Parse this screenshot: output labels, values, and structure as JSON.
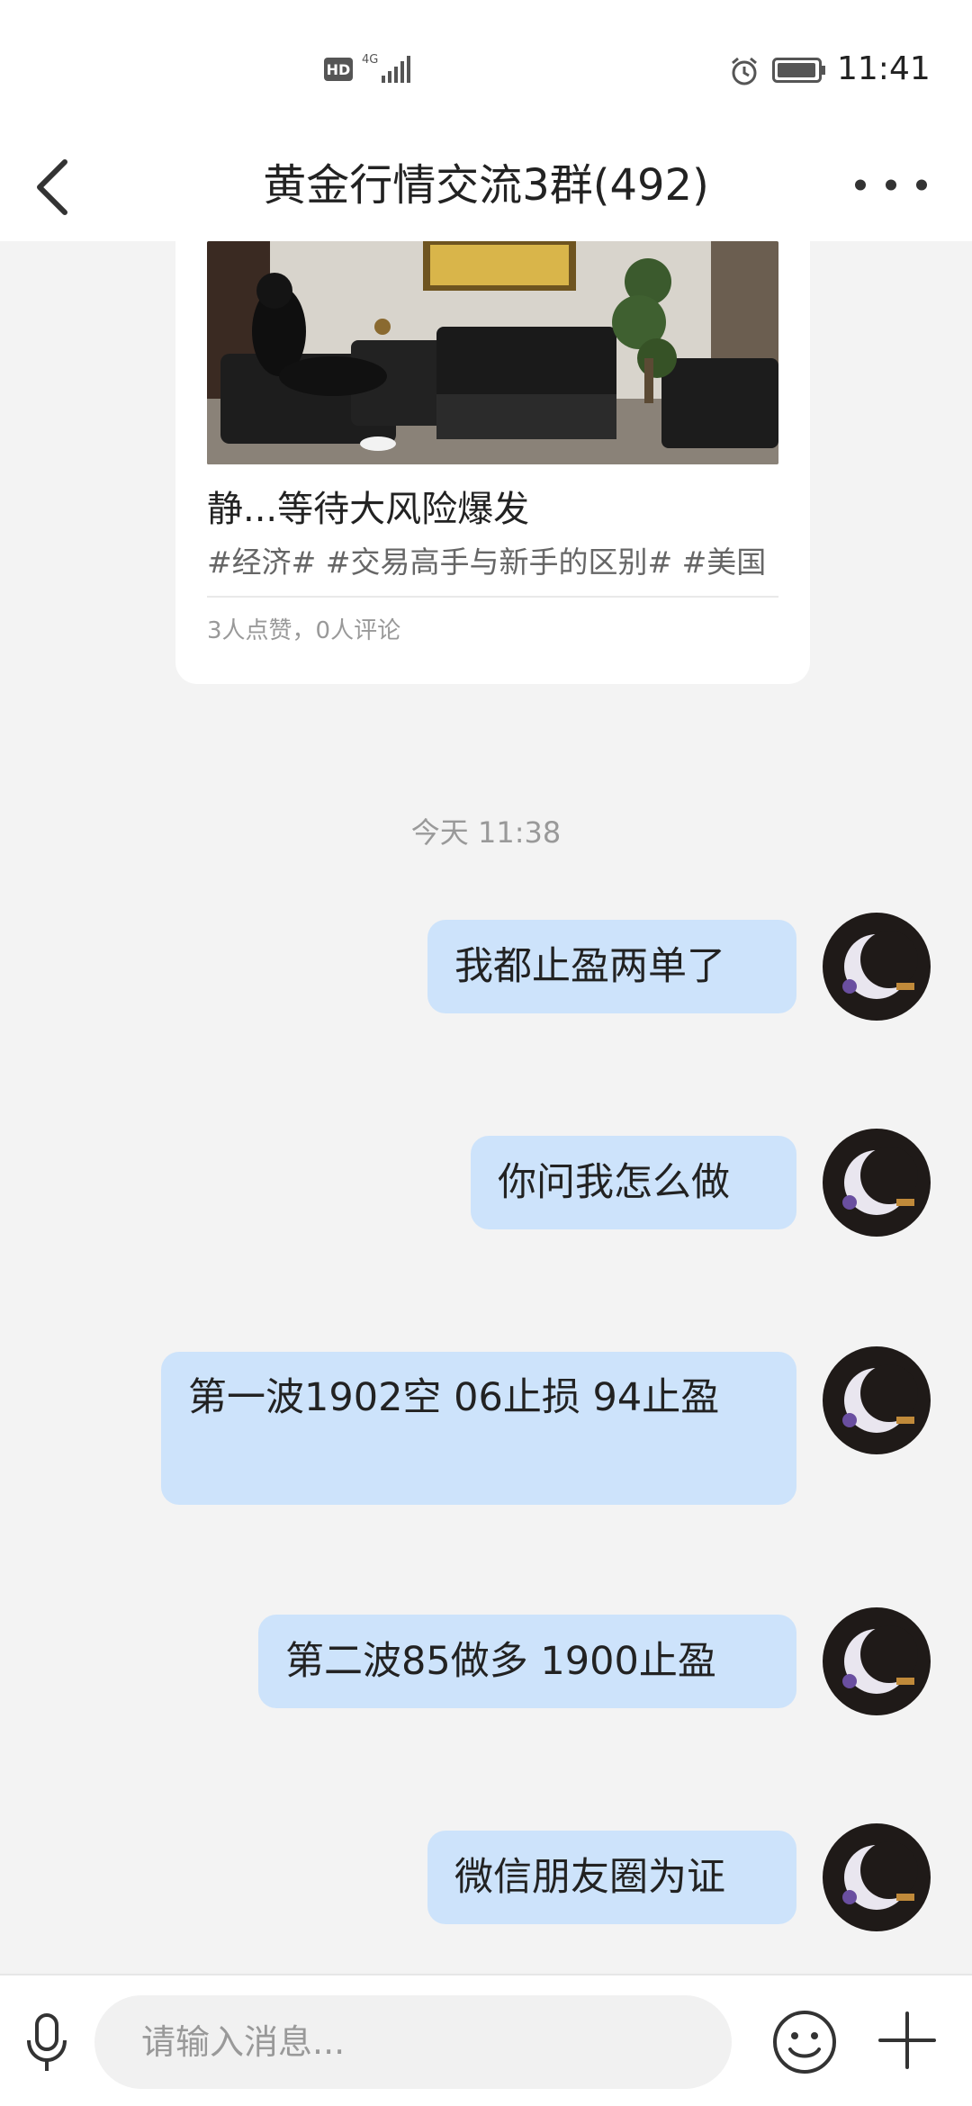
{
  "status_bar": {
    "hd": "HD",
    "network": "4G",
    "time": "11:41"
  },
  "header": {
    "title": "黄金行情交流3群(492)",
    "back_icon": "chevron-left-icon",
    "more_icon": "more-dots-icon"
  },
  "post_card": {
    "title": "静...等待大风险爆发",
    "tags": "#经济# #交易高手与新手的区别# #美国",
    "stats": "3人点赞，0人评论"
  },
  "time_separator": "今天 11:38",
  "messages": [
    {
      "text": "我都止盈两单了"
    },
    {
      "text": "你问我怎么做"
    },
    {
      "text": "第一波1902空  06止损 94止盈"
    },
    {
      "text": "第二波85做多  1900止盈"
    },
    {
      "text": "微信朋友圈为证"
    }
  ],
  "input_bar": {
    "placeholder": "请输入消息...",
    "mic_icon": "microphone-icon",
    "emoji_icon": "emoji-icon",
    "plus_icon": "plus-icon"
  },
  "colors": {
    "bubble": "#cde3fb",
    "background": "#f3f3f3",
    "accent_text": "#222222"
  }
}
